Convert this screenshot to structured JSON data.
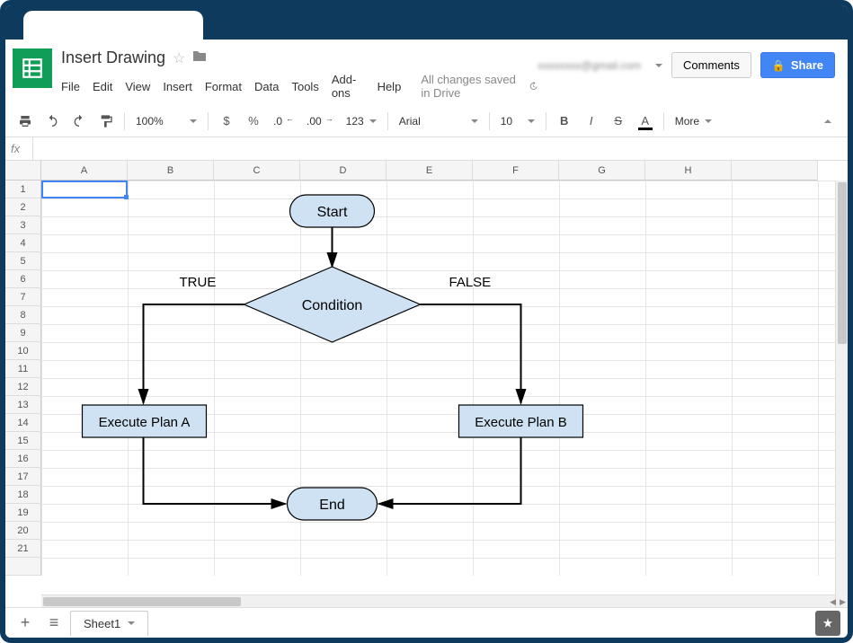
{
  "document": {
    "title": "Insert Drawing"
  },
  "menu": {
    "file": "File",
    "edit": "Edit",
    "view": "View",
    "insert": "Insert",
    "format": "Format",
    "data": "Data",
    "tools": "Tools",
    "addons": "Add-ons",
    "help": "Help",
    "save_status": "All changes saved in Drive"
  },
  "header": {
    "email": "xxxxxxxx@gmail.com",
    "comments_label": "Comments",
    "share_label": "Share"
  },
  "toolbar": {
    "zoom": "100%",
    "currency": "$",
    "percent": "%",
    "dec_less": ".0",
    "dec_more": ".00",
    "num_format": "123",
    "font": "Arial",
    "font_size": "10",
    "more": "More"
  },
  "formula_bar": {
    "fx": "fx",
    "value": ""
  },
  "columns": [
    "A",
    "B",
    "C",
    "D",
    "E",
    "F",
    "G",
    "H",
    ""
  ],
  "rows": [
    "1",
    "2",
    "3",
    "4",
    "5",
    "6",
    "7",
    "8",
    "9",
    "10",
    "11",
    "12",
    "13",
    "14",
    "15",
    "16",
    "17",
    "18",
    "19",
    "20",
    "21",
    ""
  ],
  "flowchart": {
    "start": "Start",
    "condition": "Condition",
    "true_label": "TRUE",
    "false_label": "FALSE",
    "plan_a": "Execute Plan A",
    "plan_b": "Execute Plan B",
    "end": "End"
  },
  "footer": {
    "sheet1": "Sheet1"
  },
  "chart_data": {
    "type": "flowchart",
    "nodes": [
      {
        "id": "start",
        "shape": "terminator",
        "label": "Start"
      },
      {
        "id": "cond",
        "shape": "decision",
        "label": "Condition"
      },
      {
        "id": "a",
        "shape": "process",
        "label": "Execute Plan A"
      },
      {
        "id": "b",
        "shape": "process",
        "label": "Execute Plan B"
      },
      {
        "id": "end",
        "shape": "terminator",
        "label": "End"
      }
    ],
    "edges": [
      {
        "from": "start",
        "to": "cond"
      },
      {
        "from": "cond",
        "to": "a",
        "label": "TRUE"
      },
      {
        "from": "cond",
        "to": "b",
        "label": "FALSE"
      },
      {
        "from": "a",
        "to": "end"
      },
      {
        "from": "b",
        "to": "end"
      }
    ]
  }
}
